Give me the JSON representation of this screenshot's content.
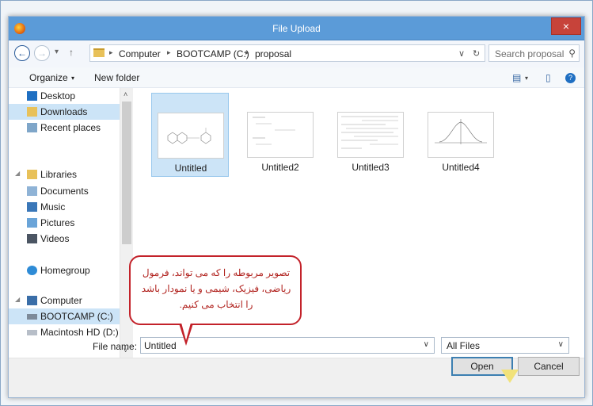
{
  "window": {
    "title": "File Upload",
    "close_glyph": "×"
  },
  "address": {
    "back_glyph": "←",
    "forward_glyph": "→",
    "recent_glyph": "▾",
    "up_glyph": "↑",
    "crumbs": [
      "Computer",
      "BOOTCAMP (C:)",
      "proposal"
    ],
    "crumb_sep": "▸",
    "dropdown_glyph": "∨",
    "refresh_glyph": "↻"
  },
  "search": {
    "placeholder": "Search proposal",
    "icon": "search-icon"
  },
  "toolbar": {
    "organize": "Organize",
    "organize_caret": "▾",
    "new_folder": "New folder",
    "view_glyph": "▤",
    "view_caret": "▾",
    "preview_glyph": "▯",
    "help_glyph": "?"
  },
  "nav": {
    "items": [
      {
        "label": "Desktop",
        "icon": "desktop-icon"
      },
      {
        "label": "Downloads",
        "icon": "downloads-icon"
      },
      {
        "label": "Recent places",
        "icon": "recent-places-icon"
      },
      {
        "label": "Libraries",
        "icon": "libraries-icon"
      },
      {
        "label": "Documents",
        "icon": "documents-icon"
      },
      {
        "label": "Music",
        "icon": "music-icon"
      },
      {
        "label": "Pictures",
        "icon": "pictures-icon"
      },
      {
        "label": "Videos",
        "icon": "videos-icon"
      },
      {
        "label": "Homegroup",
        "icon": "homegroup-icon"
      },
      {
        "label": "Computer",
        "icon": "computer-icon"
      },
      {
        "label": "BOOTCAMP (C:)",
        "icon": "drive-icon"
      },
      {
        "label": "Macintosh HD (D:)",
        "icon": "drive-icon"
      }
    ],
    "scroll_up": "˄",
    "scroll_down": "˅"
  },
  "files": [
    "Untitled",
    "Untitled2",
    "Untitled3",
    "Untitled4"
  ],
  "callout_text": "تصویر مربوطه را که می تواند، فرمول ریاضی، فیزیک، شیمی و یا نمودار باشد را انتخاب می کنیم.",
  "bottom": {
    "filename_label": "File name:",
    "filename_value": "Untitled",
    "filter_value": "All Files",
    "open": "Open",
    "cancel": "Cancel",
    "caret": "∨"
  },
  "colors": {
    "titlebar": "#5b9bd8",
    "selection": "#cce4f7",
    "callout_border": "#c3222a"
  }
}
